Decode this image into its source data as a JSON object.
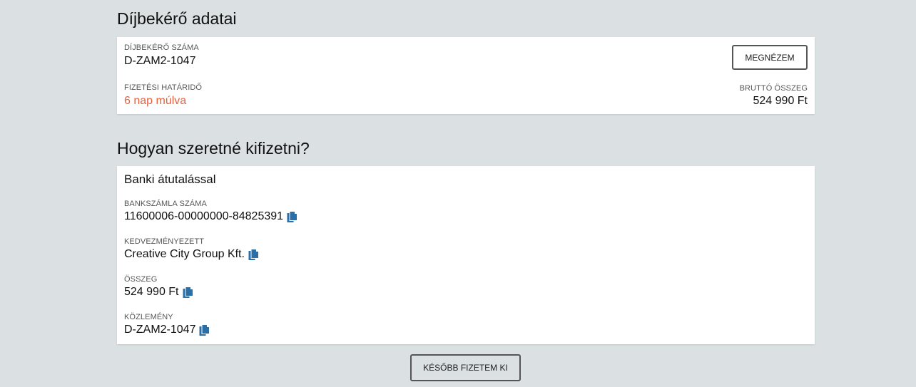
{
  "invoice": {
    "heading": "Díjbekérő adatai",
    "number_label": "DÍJBEKÉRŐ SZÁMA",
    "number_value": "D-ZAM2-1047",
    "due_label": "FIZETÉSI HATÁRIDŐ",
    "due_value": "6 nap múlva",
    "view_button": "MEGNÉZEM",
    "gross_label": "BRUTTÓ ÖSSZEG",
    "gross_value": "524 990 Ft"
  },
  "payment": {
    "heading": "Hogyan szeretné kifizetni?",
    "method_title": "Banki átutalással",
    "fields": [
      {
        "label": "BANKSZÁMLA SZÁMA",
        "value": "11600006-00000000-84825391",
        "icon": "copy-icon"
      },
      {
        "label": "KEDVEZMÉNYEZETT",
        "value": "Creative City Group Kft.",
        "icon": "copy-icon"
      },
      {
        "label": "ÖSSZEG",
        "value": "524 990 Ft",
        "icon": "copy-icon"
      },
      {
        "label": "KÖZLEMÉNY",
        "value": "D-ZAM2-1047",
        "icon": "copy-icon"
      }
    ]
  },
  "later_button": "KÉSŐBB FIZETEM KI",
  "colors": {
    "background": "#dbe0e3",
    "due_text": "#e8603c",
    "copy_icon": "#2a6fa8"
  }
}
